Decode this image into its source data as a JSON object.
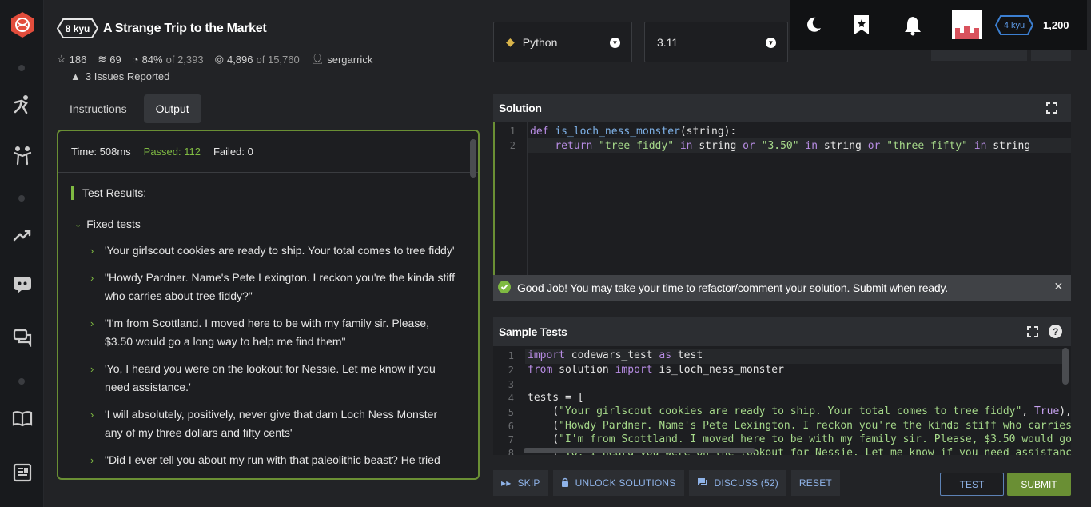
{
  "kata": {
    "rank": "8 kyu",
    "title": "A Strange Trip to the Market",
    "stars": "186",
    "collections": "69",
    "satisfaction": "84%",
    "votes_of": "of 2,393",
    "completed": "4,896",
    "attempts_of": "of 15,760",
    "author": "sergarrick",
    "issues": "3 Issues Reported"
  },
  "tabs": [
    {
      "label": "Instructions",
      "active": false
    },
    {
      "label": "Output",
      "active": true
    }
  ],
  "output": {
    "time": "Time: 508ms",
    "passed": "Passed: 112",
    "failed": "Failed: 0",
    "results_title": "Test Results:",
    "group_title": "Fixed tests",
    "tests": [
      "'Your girlscout cookies are ready to ship. Your total comes to tree fiddy'",
      "\"Howdy Pardner. Name's Pete Lexington. I reckon you're the kinda stiff who carries about tree fiddy?\"",
      "\"I'm from Scottland. I moved here to be with my family sir. Please, $3.50 would go a long way to help me find them\"",
      "'Yo, I heard you were on the lookout for Nessie. Let me know if you need assistance.'",
      "'I will absolutely, positively, never give that darn Loch Ness Monster any of my three dollars and fifty cents'",
      "\"Did I ever tell you about my run with that paleolithic beast? He tried"
    ]
  },
  "language": {
    "selected": "Python",
    "version": "3.11"
  },
  "user": {
    "rank": "4 kyu",
    "honor": "1,200"
  },
  "solution": {
    "title": "Solution",
    "lines": [
      "1",
      "2"
    ]
  },
  "banner": "Good Job! You may take your time to refactor/comment your solution. Submit when ready.",
  "sample_tests": {
    "title": "Sample Tests",
    "lines": [
      "1",
      "2",
      "3",
      "4",
      "5",
      "6",
      "7",
      "8"
    ]
  },
  "actions": {
    "skip": "SKIP",
    "unlock": "UNLOCK SOLUTIONS",
    "discuss": "DISCUSS (52)",
    "reset": "RESET",
    "test": "TEST",
    "submit": "SUBMIT"
  },
  "colors": {
    "accent_green": "#6a8f34",
    "brand_red": "#e24d3c",
    "link_blue": "#8fb3e8"
  }
}
